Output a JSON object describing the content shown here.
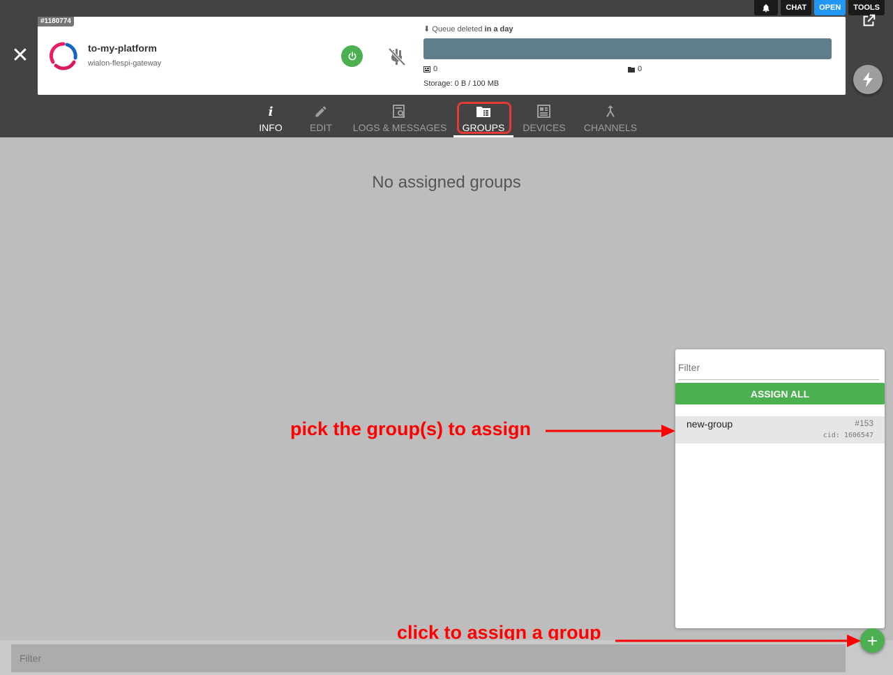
{
  "top_buttons": {
    "chat": "CHAT",
    "open": "OPEN",
    "tools": "TOOLS"
  },
  "item": {
    "id": "#1180774",
    "name": "to-my-platform",
    "type": "wialon-flespi-gateway",
    "queue_prefix": "Queue deleted",
    "queue_when": "in a day",
    "stat_messages": "0",
    "stat_files": "0",
    "storage": "Storage: 0 B / 100 MB",
    "status_color": "#4caf50"
  },
  "tabs": [
    {
      "label": "INFO",
      "icon": "info-icon"
    },
    {
      "label": "EDIT",
      "icon": "pencil-icon"
    },
    {
      "label": "LOGS & MESSAGES",
      "icon": "logs-icon"
    },
    {
      "label": "GROUPS",
      "icon": "groups-icon",
      "active": true
    },
    {
      "label": "DEVICES",
      "icon": "devices-icon"
    },
    {
      "label": "CHANNELS",
      "icon": "channels-icon"
    }
  ],
  "main": {
    "empty_message": "No assigned groups"
  },
  "panel": {
    "filter_placeholder": "Filter",
    "assign_all_label": "ASSIGN ALL",
    "groups": [
      {
        "name": "new-group",
        "id": "#153",
        "cid": "cid: 1606547"
      }
    ]
  },
  "annotations": {
    "pick": "pick the group(s) to assign",
    "click": "click to assign a group",
    "color": "#ff0000"
  },
  "bottom": {
    "filter_placeholder": "Filter",
    "add_label": "+"
  },
  "colors": {
    "header_bg": "#434343",
    "accent_green": "#4caf50",
    "open_blue": "#2196f3",
    "queue_bar": "#607d8b"
  }
}
